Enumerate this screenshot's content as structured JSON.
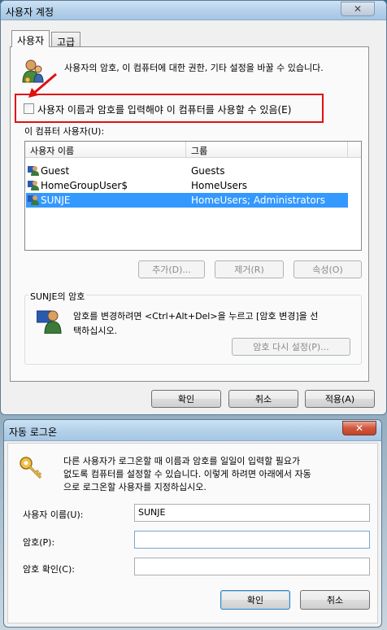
{
  "dialog1": {
    "title": "사용자 계정",
    "close": "✕",
    "tabs": [
      "사용자",
      "고급"
    ],
    "intro": "사용자의 암호, 이 컴퓨터에 대한  권한, 기타 설정을 바꿀 수 있습니다.",
    "checkbox_label": "사용자 이름과 암호를 입력해야 이 컴퓨터를 사용할 수 있음(E)",
    "users_label": "이 컴퓨터 사용자(U):",
    "columns": [
      "사용자 이름",
      "그룹"
    ],
    "rows": [
      {
        "name": "Guest",
        "group": "Guests"
      },
      {
        "name": "HomeGroupUser$",
        "group": "HomeUsers"
      },
      {
        "name": "SUNJE",
        "group": "HomeUsers; Administrators"
      }
    ],
    "selected_row": 2,
    "add_button": "추가(D)...",
    "remove_button": "제거(R)",
    "properties_button": "속성(O)",
    "password_group": "SUNJE의 암호",
    "password_text_1": "암호를 변경하려면 <Ctrl+Alt+Del>을 누르고 [암호 변경]을 선",
    "password_text_2": "택하십시오.",
    "reset_password_button": "암호 다시 설정(P)...",
    "ok_button": "확인",
    "cancel_button": "취소",
    "apply_button": "적용(A)"
  },
  "dialog2": {
    "title": "자동 로그온",
    "close": "✕",
    "desc_1": "다른 사용자가 로그온할 때 이름과 암호를 일일이 입력할 필요가",
    "desc_2": "없도록 컴퓨터를 설정할 수 있습니다. 이렇게 하려면 아래에서 자동",
    "desc_3": "으로 로그온할 사용자를 지정하십시오.",
    "username_label": "사용자 이름(U):",
    "username_value": "SUNJE",
    "password_label": "암호(P):",
    "password_value": "",
    "confirm_label": "암호 확인(C):",
    "confirm_value": "",
    "ok_button": "확인",
    "cancel_button": "취소"
  },
  "icons": [
    "users-icon",
    "user-icon",
    "key-icon",
    "checkbox-icon",
    "close-icon",
    "arrow-icon"
  ],
  "colors": {
    "selection": "#3399ff",
    "highlight_box": "#e01010"
  }
}
